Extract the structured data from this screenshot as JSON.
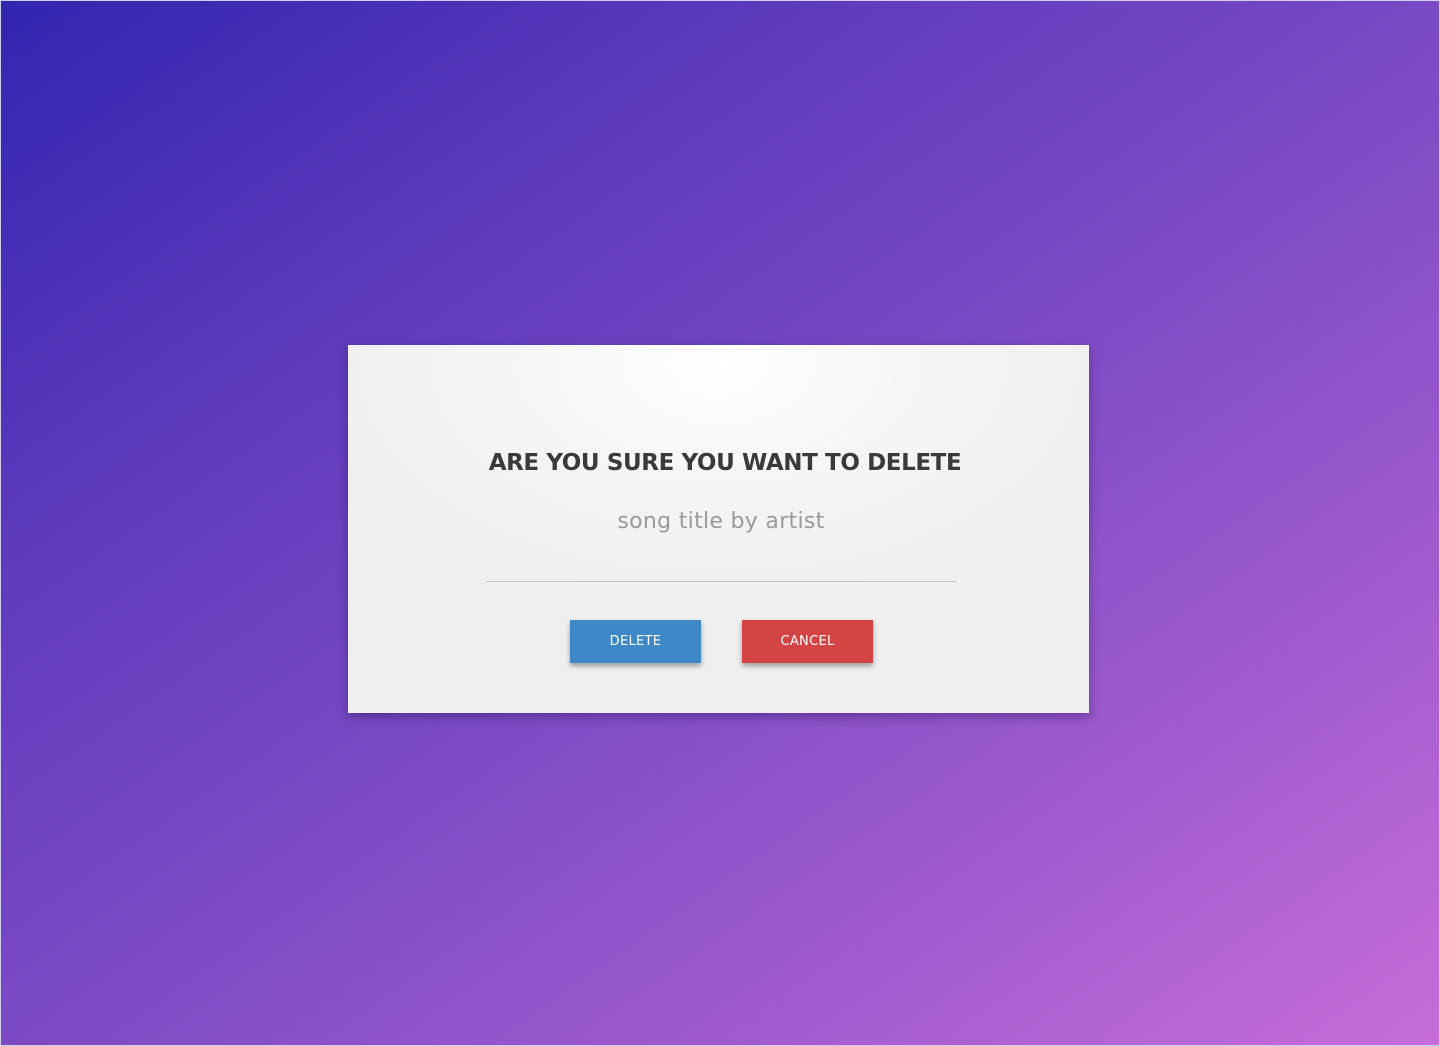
{
  "dialog": {
    "title": "ARE YOU SURE YOU WANT TO DELETE",
    "subtitle": "song title by artist",
    "delete_label": "DELETE",
    "cancel_label": "CANCEL"
  },
  "colors": {
    "background_start": "#3225b0",
    "background_end": "#c66dd9",
    "dialog_background": "#f2f2f2",
    "title_text": "#3a3a3a",
    "subtitle_text": "#9a9a9a",
    "delete_button": "#3f88c7",
    "cancel_button": "#d54444"
  }
}
